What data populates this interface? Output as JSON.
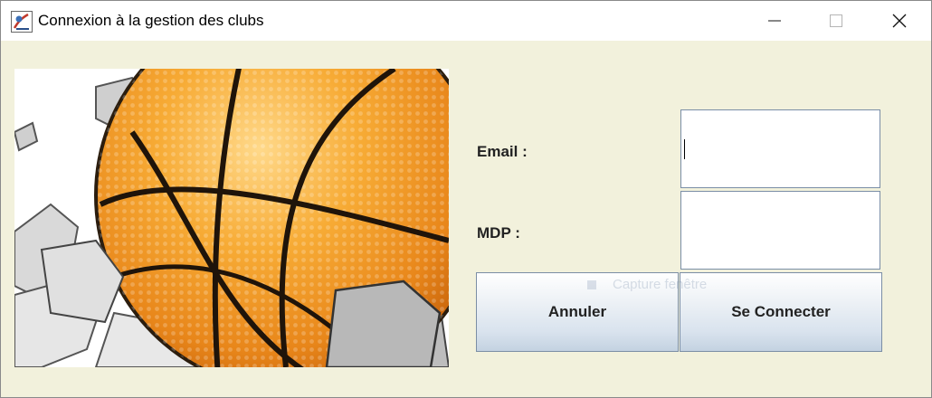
{
  "window": {
    "title": "Connexion à la gestion des clubs",
    "icon": "java-app-icon",
    "controls": [
      "minimize-icon",
      "maximize-icon",
      "close-icon"
    ]
  },
  "hero_image": {
    "description_icon": "basketball-illustration"
  },
  "form": {
    "email_label": "Email  :",
    "email_value": "",
    "password_label": "MDP :",
    "password_value": ""
  },
  "buttons": {
    "cancel_label": "Annuler",
    "connect_label": "Se Connecter"
  },
  "overlay": {
    "ghost_text": "Capture fenêtre"
  },
  "colors": {
    "window_background": "#f2f1dc",
    "titlebar_background": "#ffffff",
    "field_border": "#7a8ea6",
    "ball_orange": "#f3a02c"
  }
}
